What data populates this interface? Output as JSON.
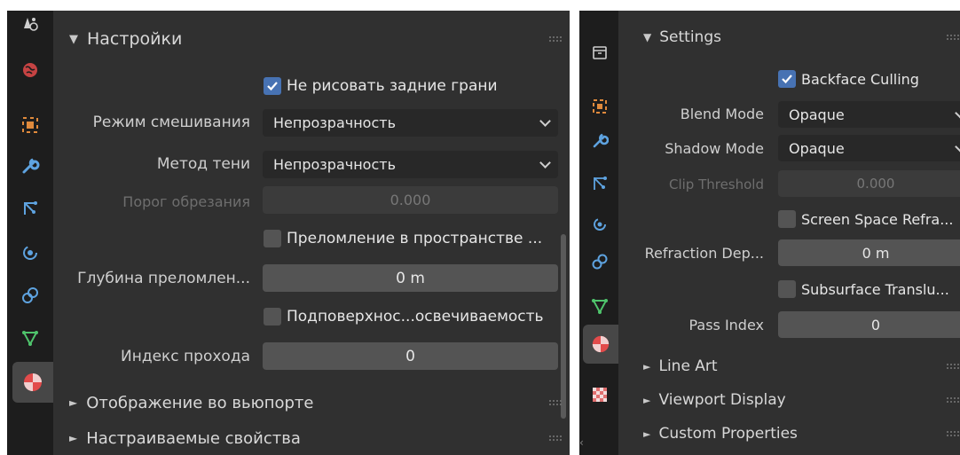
{
  "left_panel": {
    "settings_header": "Настройки",
    "backface_culling": "Не рисовать задние грани",
    "blend_mode_label": "Режим смешивания",
    "blend_mode_value": "Непрозрачность",
    "shadow_method_label": "Метод тени",
    "shadow_method_value": "Непрозрачность",
    "clip_threshold_label": "Порог обрезания",
    "clip_threshold_value": "0.000",
    "screen_space_refraction": "Преломление в пространстве ...",
    "refraction_depth_label": "Глубина преломлен...",
    "refraction_depth_value": "0 m",
    "subsurface_translucency": "Подповерхнос...освечиваемость",
    "pass_index_label": "Индекс прохода",
    "pass_index_value": "0",
    "viewport_display_header": "Отображение во вьюпорте",
    "custom_properties_header": "Настраиваемые свойства"
  },
  "right_panel": {
    "settings_header": "Settings",
    "backface_culling": "Backface Culling",
    "blend_mode_label": "Blend Mode",
    "blend_mode_value": "Opaque",
    "shadow_mode_label": "Shadow Mode",
    "shadow_mode_value": "Opaque",
    "clip_threshold_label": "Clip Threshold",
    "clip_threshold_value": "0.000",
    "screen_space_refraction": "Screen Space Refra...",
    "refraction_depth_label": "Refraction Dep...",
    "refraction_depth_value": "0 m",
    "subsurface_translucency": "Subsurface Translu...",
    "pass_index_label": "Pass Index",
    "pass_index_value": "0",
    "line_art_header": "Line Art",
    "viewport_display_header": "Viewport Display",
    "custom_properties_header": "Custom Properties"
  },
  "checkbox_states": {
    "backface_culling": true,
    "screen_space_refraction": false,
    "subsurface_translucency": false
  },
  "colors": {
    "panel_bg": "#303030",
    "sidebar_bg": "#1d1d1d",
    "field_bg": "#545454",
    "dropdown_bg": "#282828",
    "accent_blue": "#4772b3"
  },
  "icons": {
    "left_sidebar": [
      "scene-icon",
      "world-icon",
      "object-icon",
      "modifier-wrench-icon",
      "particles-icon",
      "physics-icon",
      "constraints-icon",
      "object-data-icon",
      "material-icon"
    ],
    "right_sidebar": [
      "collection-icon",
      "object-icon",
      "modifier-wrench-icon",
      "particles-icon",
      "physics-icon",
      "constraints-icon",
      "object-data-icon",
      "material-icon",
      "texture-icon"
    ]
  }
}
